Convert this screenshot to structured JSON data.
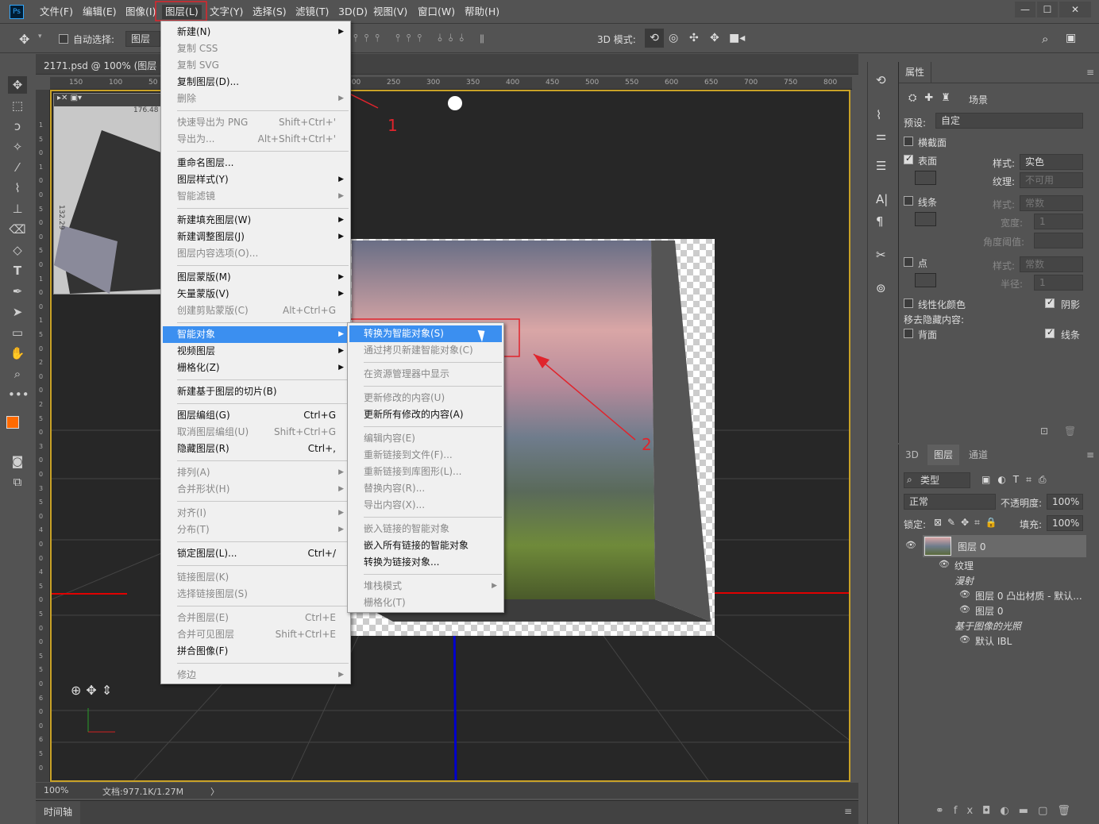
{
  "app_logo": "Ps",
  "menubar": [
    "文件(F)",
    "编辑(E)",
    "图像(I)",
    "图层(L)",
    "文字(Y)",
    "选择(S)",
    "滤镜(T)",
    "3D(D)",
    "视图(V)",
    "窗口(W)",
    "帮助(H)"
  ],
  "window_controls": {
    "minimize": "—",
    "maximize": "☐",
    "close": "✕"
  },
  "options": {
    "auto_select_label": "自动选择:",
    "auto_select_value": "图层",
    "mode_3d": "3D 模式:"
  },
  "doc_tab": "2171.psd @ 100% (图层 0,",
  "ruler_ticks": [
    "150",
    "100",
    "50",
    "0",
    "50",
    "100",
    "150",
    "200",
    "250",
    "300",
    "350",
    "400",
    "450",
    "500",
    "550",
    "600",
    "650",
    "700",
    "750",
    "800"
  ],
  "ruler_left_ticks": [
    "1",
    "5",
    "0",
    "1",
    "0",
    "0",
    "5",
    "0",
    "0",
    "5",
    "0",
    "1",
    "0",
    "0",
    "1",
    "5",
    "0",
    "2",
    "0",
    "0",
    "2",
    "5",
    "0",
    "3",
    "0",
    "0",
    "3",
    "5",
    "0",
    "4",
    "0",
    "0",
    "4",
    "5",
    "0",
    "5",
    "0",
    "0",
    "5",
    "5",
    "0",
    "6",
    "0",
    "0",
    "6",
    "5",
    "0"
  ],
  "nav": {
    "measure_a": "176.48",
    "measure_b": "132.29"
  },
  "status": {
    "zoom": "100%",
    "doc": "文档:977.1K/1.27M",
    "arrow": "〉"
  },
  "timeline": "时间轴",
  "annotations": {
    "label1": "1",
    "label2": "2"
  },
  "layer_menu": [
    {
      "label": "新建(N)",
      "arrow": true
    },
    {
      "label": "复制 CSS",
      "dis": true
    },
    {
      "label": "复制 SVG",
      "dis": true
    },
    {
      "label": "复制图层(D)..."
    },
    {
      "label": "删除",
      "dis": true,
      "arrow": true
    },
    {
      "sep": true
    },
    {
      "label": "快速导出为 PNG",
      "sc": "Shift+Ctrl+'",
      "dis": true
    },
    {
      "label": "导出为...",
      "sc": "Alt+Shift+Ctrl+'",
      "dis": true
    },
    {
      "sep": true
    },
    {
      "label": "重命名图层..."
    },
    {
      "label": "图层样式(Y)",
      "arrow": true
    },
    {
      "label": "智能滤镜",
      "dis": true,
      "arrow": true
    },
    {
      "sep": true
    },
    {
      "label": "新建填充图层(W)",
      "arrow": true
    },
    {
      "label": "新建调整图层(J)",
      "arrow": true
    },
    {
      "label": "图层内容选项(O)...",
      "dis": true
    },
    {
      "sep": true
    },
    {
      "label": "图层蒙版(M)",
      "arrow": true
    },
    {
      "label": "矢量蒙版(V)",
      "arrow": true
    },
    {
      "label": "创建剪贴蒙版(C)",
      "sc": "Alt+Ctrl+G",
      "dis": true
    },
    {
      "sep": true
    },
    {
      "label": "智能对象",
      "arrow": true,
      "hl": true
    },
    {
      "label": "视频图层",
      "arrow": true
    },
    {
      "label": "栅格化(Z)",
      "arrow": true
    },
    {
      "sep": true
    },
    {
      "label": "新建基于图层的切片(B)"
    },
    {
      "sep": true
    },
    {
      "label": "图层编组(G)",
      "sc": "Ctrl+G"
    },
    {
      "label": "取消图层编组(U)",
      "sc": "Shift+Ctrl+G",
      "dis": true
    },
    {
      "label": "隐藏图层(R)",
      "sc": "Ctrl+,"
    },
    {
      "sep": true
    },
    {
      "label": "排列(A)",
      "dis": true,
      "arrow": true
    },
    {
      "label": "合并形状(H)",
      "dis": true,
      "arrow": true
    },
    {
      "sep": true
    },
    {
      "label": "对齐(I)",
      "dis": true,
      "arrow": true
    },
    {
      "label": "分布(T)",
      "dis": true,
      "arrow": true
    },
    {
      "sep": true
    },
    {
      "label": "锁定图层(L)...",
      "sc": "Ctrl+/"
    },
    {
      "sep": true
    },
    {
      "label": "链接图层(K)",
      "dis": true
    },
    {
      "label": "选择链接图层(S)",
      "dis": true
    },
    {
      "sep": true
    },
    {
      "label": "合并图层(E)",
      "sc": "Ctrl+E",
      "dis": true
    },
    {
      "label": "合并可见图层",
      "sc": "Shift+Ctrl+E",
      "dis": true
    },
    {
      "label": "拼合图像(F)"
    },
    {
      "sep": true
    },
    {
      "label": "修边",
      "dis": true,
      "arrow": true
    }
  ],
  "smart_menu": [
    {
      "label": "转换为智能对象(S)",
      "hl": true
    },
    {
      "label": "通过拷贝新建智能对象(C)",
      "dis": true
    },
    {
      "sep": true
    },
    {
      "label": "在资源管理器中显示",
      "dis": true
    },
    {
      "sep": true
    },
    {
      "label": "更新修改的内容(U)",
      "dis": true
    },
    {
      "label": "更新所有修改的内容(A)"
    },
    {
      "sep": true
    },
    {
      "label": "编辑内容(E)",
      "dis": true
    },
    {
      "label": "重新链接到文件(F)...",
      "dis": true
    },
    {
      "label": "重新链接到库图形(L)...",
      "dis": true
    },
    {
      "label": "替换内容(R)...",
      "dis": true
    },
    {
      "label": "导出内容(X)...",
      "dis": true
    },
    {
      "sep": true
    },
    {
      "label": "嵌入链接的智能对象",
      "dis": true
    },
    {
      "label": "嵌入所有链接的智能对象"
    },
    {
      "label": "转换为链接对象..."
    },
    {
      "sep": true
    },
    {
      "label": "堆栈模式",
      "dis": true,
      "arrow": true
    },
    {
      "label": "栅格化(T)",
      "dis": true
    }
  ],
  "props": {
    "tab": "属性",
    "scene": "场景",
    "preset_label": "预设:",
    "preset_value": "自定",
    "cross_section": "横截面",
    "surface": "表面",
    "style_label": "样式:",
    "surface_style": "实色",
    "texture_label": "纹理:",
    "texture_value": "不可用",
    "lines": "线条",
    "lines_style": "常数",
    "width_label": "宽度:",
    "width_value": "1",
    "angle_label": "角度阈值:",
    "points": "点",
    "points_style": "常数",
    "radius_label": "半径:",
    "radius_value": "1",
    "linearize": "线性化颜色",
    "shadow": "阴影",
    "remove_hidden": "移去隐藏内容:",
    "backface": "背面",
    "lines2": "线条"
  },
  "layers": {
    "tabs": [
      "3D",
      "图层",
      "通道"
    ],
    "filter_kind": "类型",
    "blend": "正常",
    "opacity_label": "不透明度:",
    "opacity": "100%",
    "lock_label": "锁定:",
    "fill_label": "填充:",
    "fill": "100%",
    "items": [
      {
        "name": "图层 0",
        "indent": 0,
        "eye": true,
        "thumb": true
      },
      {
        "name": "纹理",
        "indent": 1,
        "eye": true
      },
      {
        "name": "漫射",
        "indent": 2,
        "italic": true
      },
      {
        "name": "图层 0 凸出材质 - 默认...",
        "indent": 3,
        "eye": true
      },
      {
        "name": "图层 0",
        "indent": 3,
        "eye": true
      },
      {
        "name": "基于图像的光照",
        "indent": 2,
        "italic": true
      },
      {
        "name": "默认 IBL",
        "indent": 3,
        "eye": true
      }
    ]
  },
  "colors": {
    "accent": "#3b8ff0",
    "foreground": "#ff6a00",
    "annotation": "#e0242c",
    "guide": "#e00000",
    "axis": "#0000cc"
  }
}
